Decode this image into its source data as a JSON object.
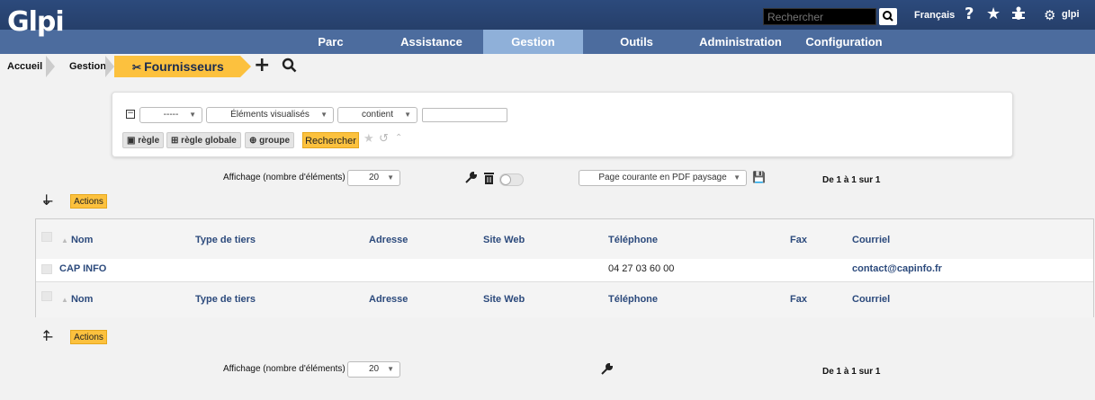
{
  "header": {
    "logo": "Glpi",
    "search_placeholder": "Rechercher",
    "language": "Français",
    "user": "glpi"
  },
  "menu": [
    {
      "label": "Parc"
    },
    {
      "label": "Assistance"
    },
    {
      "label": "Gestion"
    },
    {
      "label": "Outils"
    },
    {
      "label": "Administration"
    },
    {
      "label": "Configuration"
    }
  ],
  "breadcrumb": {
    "home": "Accueil",
    "section": "Gestion",
    "current": "Fournisseurs"
  },
  "search": {
    "field1": "-----",
    "field2": "Éléments visualisés",
    "operator": "contient",
    "value": "",
    "btn_rule": "règle",
    "btn_global_rule": "règle globale",
    "btn_group": "groupe",
    "btn_search": "Rechercher"
  },
  "pager_top": {
    "label": "Affichage (nombre d'éléments)",
    "count": "20",
    "export": "Page courante en PDF paysage",
    "range": "De 1 à 1 sur 1"
  },
  "actions_label": "Actions",
  "table": {
    "columns": [
      "Nom",
      "Type de tiers",
      "Adresse",
      "Site Web",
      "Téléphone",
      "Fax",
      "Courriel"
    ],
    "rows": [
      {
        "nom": "CAP INFO",
        "type": "",
        "adresse": "",
        "site": "",
        "telephone": "04 27 03 60 00",
        "fax": "",
        "courriel": "contact@capinfo.fr"
      }
    ]
  },
  "pager_bottom": {
    "label": "Affichage (nombre d'éléments)",
    "count": "20",
    "range": "De 1 à 1 sur 1"
  },
  "colors": {
    "topbar": "#2c4a7c",
    "menubar": "#4c6c9e",
    "active_menu": "#8fb0d9",
    "accent": "#fcc13e",
    "link": "#2c4a7c"
  }
}
